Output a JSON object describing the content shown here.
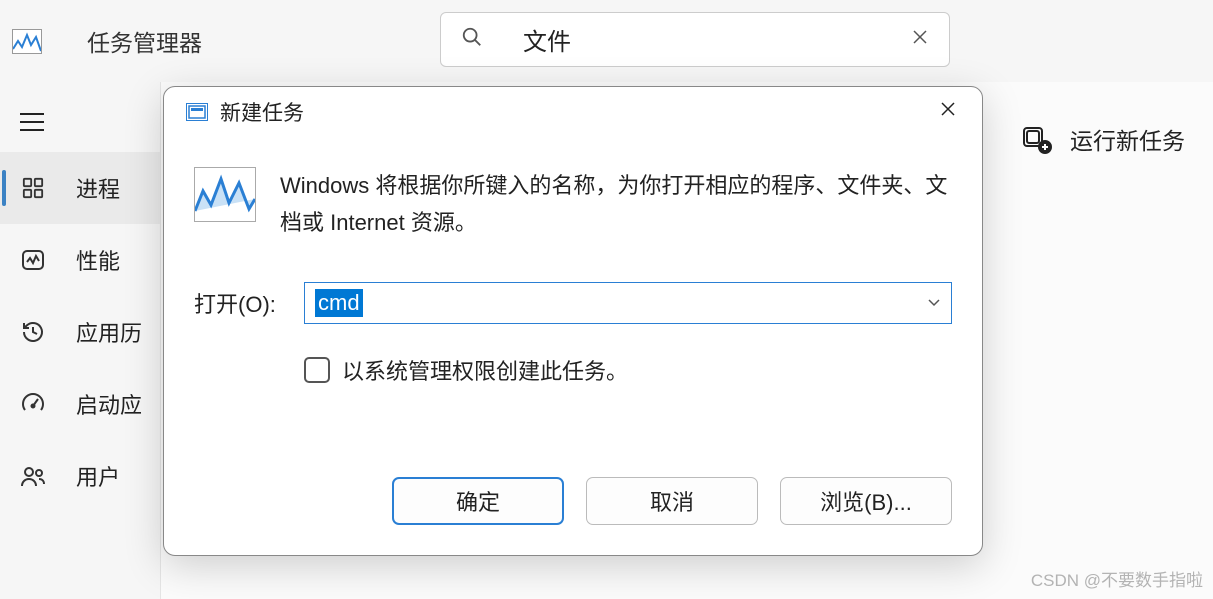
{
  "header": {
    "app_title": "任务管理器",
    "search_value": "文件"
  },
  "sidebar": {
    "items": [
      {
        "label": "进程"
      },
      {
        "label": "性能"
      },
      {
        "label": "应用历"
      },
      {
        "label": "启动应"
      },
      {
        "label": "用户"
      }
    ]
  },
  "main": {
    "run_new_task_label": "运行新任务"
  },
  "dialog": {
    "title": "新建任务",
    "description": "Windows 将根据你所键入的名称，为你打开相应的程序、文件夹、文档或 Internet 资源。",
    "open_label": "打开(O):",
    "open_value": "cmd",
    "admin_label": "以系统管理权限创建此任务。",
    "buttons": {
      "ok": "确定",
      "cancel": "取消",
      "browse": "浏览(B)..."
    }
  },
  "watermark": "CSDN @不要数手指啦"
}
